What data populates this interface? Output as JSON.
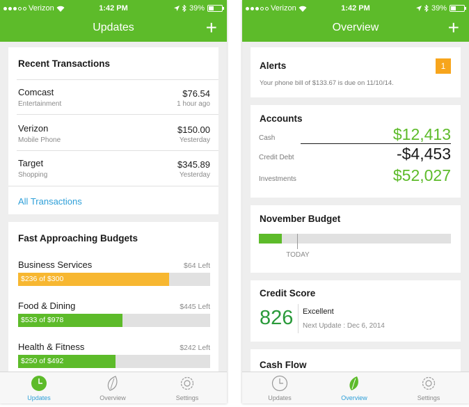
{
  "status": {
    "carrier": "Verizon",
    "time": "1:42 PM",
    "battery": "39%"
  },
  "colors": {
    "brand_green": "#5dbb2a",
    "budget_orange": "#f7b731",
    "link_blue": "#2e9fd8",
    "badge_orange": "#f7a51c"
  },
  "updates": {
    "title": "Updates",
    "recent_title": "Recent Transactions",
    "transactions": [
      {
        "name": "Comcast",
        "category": "Entertainment",
        "amount": "$76.54",
        "when": "1 hour ago"
      },
      {
        "name": "Verizon",
        "category": "Mobile Phone",
        "amount": "$150.00",
        "when": "Yesterday"
      },
      {
        "name": "Target",
        "category": "Shopping",
        "amount": "$345.89",
        "when": "Yesterday"
      }
    ],
    "all_link": "All Transactions",
    "budgets_title": "Fast Approaching Budgets",
    "budgets": [
      {
        "name": "Business Services",
        "left": "$64 Left",
        "label": "$236 of $300",
        "fraction": 0.787,
        "color": "#f7b731"
      },
      {
        "name": "Food & Dining",
        "left": "$445 Left",
        "label": "$533 of $978",
        "fraction": 0.545,
        "color": "#5dbb2a"
      },
      {
        "name": "Health & Fitness",
        "left": "$242 Left",
        "label": "$250 of $492",
        "fraction": 0.508,
        "color": "#5dbb2a"
      }
    ]
  },
  "overview": {
    "title": "Overview",
    "alerts": {
      "title": "Alerts",
      "count": "1",
      "message": "Your phone bill of $133.67 is due on 11/10/14."
    },
    "accounts": {
      "title": "Accounts",
      "rows": [
        {
          "label": "Cash",
          "value": "$12,413"
        },
        {
          "label": "Credit Debt",
          "value": "-$4,453"
        },
        {
          "label": "Investments",
          "value": "$52,027"
        }
      ]
    },
    "budget": {
      "title": "November Budget",
      "today": "TODAY",
      "progress": 0.12,
      "today_position": 0.2
    },
    "credit": {
      "title": "Credit Score",
      "score": "826",
      "rating": "Excellent",
      "next_update": "Next Update : Dec 6, 2014"
    },
    "cashflow": {
      "title": "Cash Flow"
    }
  },
  "tabs": [
    {
      "label": "Updates",
      "icon": "clock-icon"
    },
    {
      "label": "Overview",
      "icon": "leaf-icon"
    },
    {
      "label": "Settings",
      "icon": "gear-icon"
    }
  ]
}
